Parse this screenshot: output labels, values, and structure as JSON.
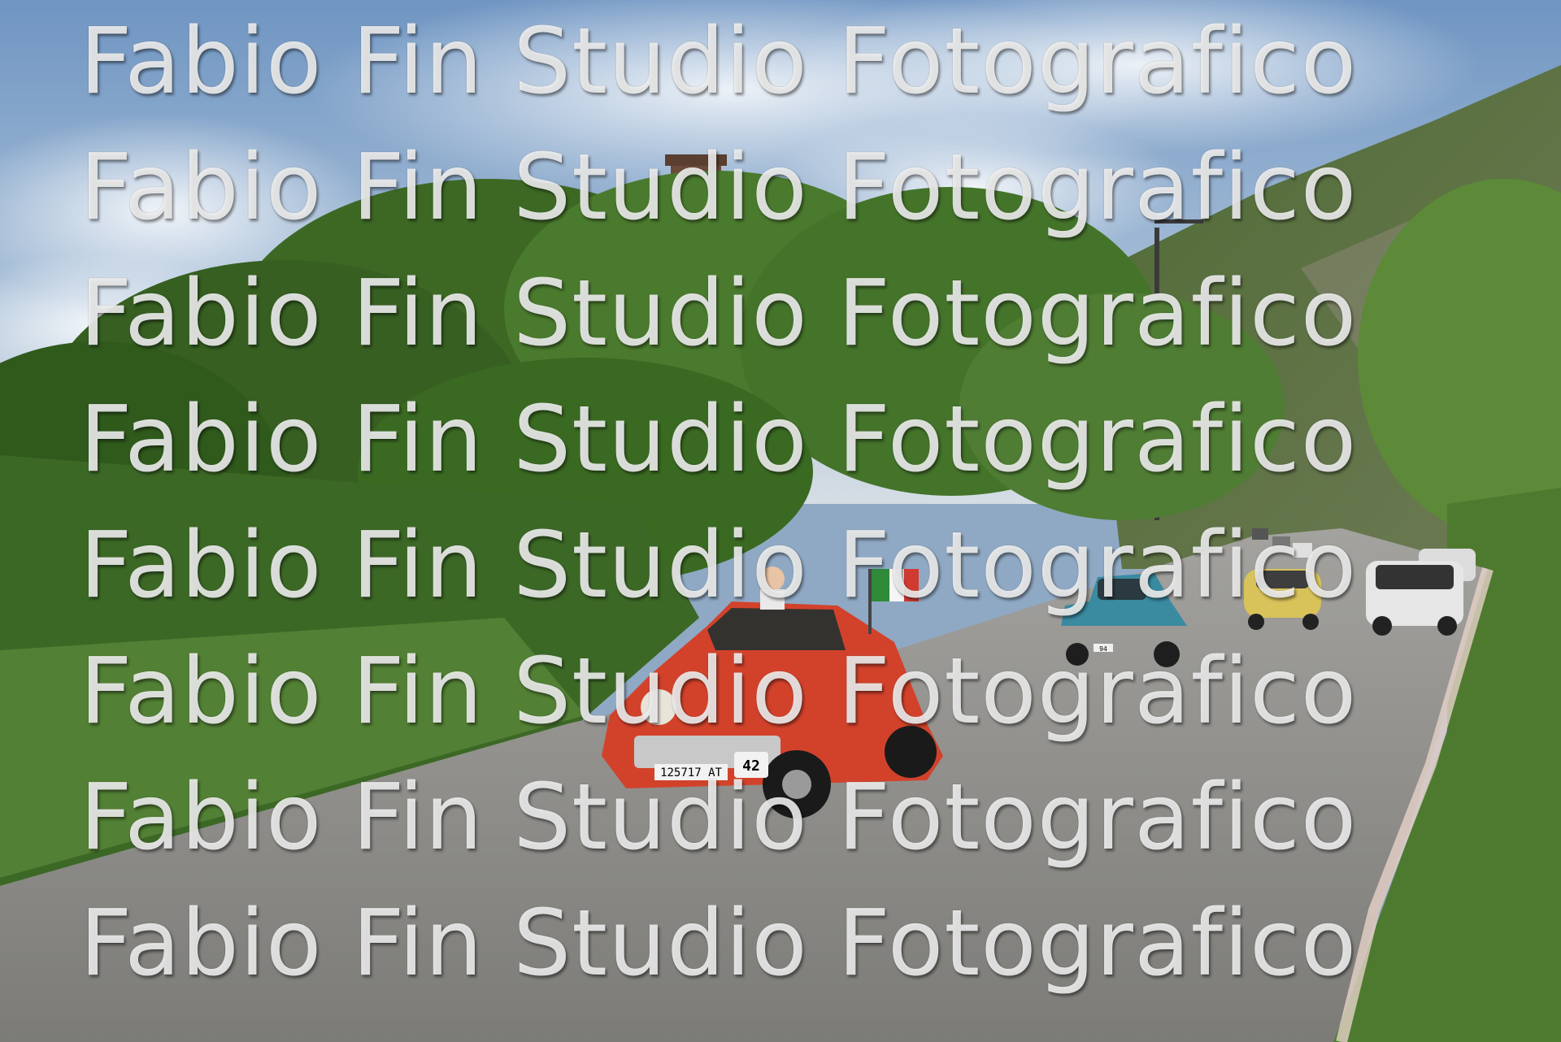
{
  "photo": {
    "red_car_plate": "125717 AT",
    "red_car_rally_number": "42",
    "blue_car_plate": "94"
  },
  "watermark": {
    "lines": [
      "Fabio Fin Studio Fotografico",
      "Fabio Fin Studio Fotografico",
      "Fabio Fin Studio Fotografico",
      "Fabio Fin Studio Fotografico",
      "Fabio Fin Studio Fotografico",
      "Fabio Fin Studio Fotografico",
      "Fabio Fin Studio Fotografico",
      "Fabio Fin Studio Fotografico"
    ]
  },
  "colors": {
    "sky": "#7fa2c8",
    "foliage": "#3f6a26",
    "road": "#8b8a86",
    "red_car": "#d2422b",
    "blue_car": "#3a8aa0",
    "yellow_car": "#d8c25a"
  }
}
